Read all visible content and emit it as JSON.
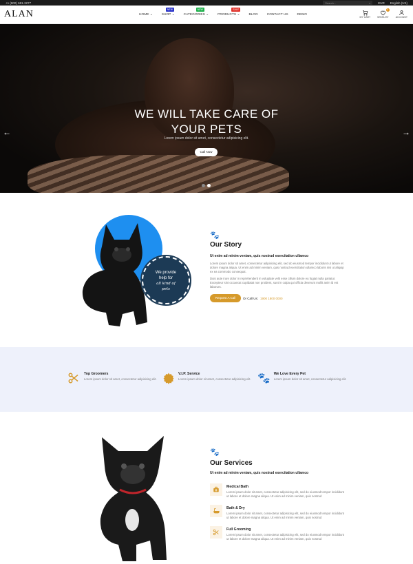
{
  "topbar": {
    "phone": "+1 (800) 681-3277",
    "search_placeholder": "Search...",
    "currency": "EUR",
    "language": "English (US)"
  },
  "header": {
    "logo": "ALAN",
    "nav": [
      {
        "label": "HOME",
        "caret": "⌄"
      },
      {
        "label": "SHOP",
        "caret": "⌄",
        "badge": "NEW",
        "badge_color": "#2b35c9"
      },
      {
        "label": "CATEGORIES",
        "caret": "⌄",
        "badge": "NEW",
        "badge_color": "#1fb14c"
      },
      {
        "label": "PRODUCTS",
        "caret": "⌄",
        "badge": "SALE",
        "badge_color": "#e0322b"
      },
      {
        "label": "BLOG",
        "caret": ""
      },
      {
        "label": "CONTACT US",
        "caret": ""
      },
      {
        "label": "DEMO",
        "caret": ""
      }
    ],
    "icons": {
      "cart": "MY CART",
      "wishlist": "WISHLIST",
      "account": "ACCOUNT",
      "wishlist_count": "0"
    }
  },
  "hero": {
    "title_line1": "WE WILL TAKE CARE OF",
    "title_line2": "YOUR PETS",
    "subtitle": "Lorem ipsum dolor sit amet, consectetur adipisicing elit.",
    "cta": "Call Now",
    "prev_icon": "arrow-left-icon",
    "next_icon": "arrow-right-icon"
  },
  "story": {
    "title": "Our Story",
    "bold": "Ut enim ad minim veniam, quis nostrud exercitation ullamco",
    "para1": "Lorem ipsum dolor sit amet, consectetur adipisicing elit, sed do eiusmod tempor incididunt ut labore et dolore magna aliqua. Ut enim ad minim veniam, quis nostrud exercitation ullamco laboris nisi ut aliquip ex ea commodo consequat.",
    "para2": "Duis aute irure dolor in reprehenderit in voluptate velit esse cillum dolore eu fugiat nulla pariatur. Excepteur sint occaecat cupidatat non proident, sunt in culpa qui officia deserunt mollit anim id est laborum.",
    "button": "Request A Call",
    "or_call": "Or Call Us:",
    "phone": "1900 1800 0000",
    "bubble_line1": "We provide",
    "bubble_line2": "help for",
    "bubble_line3": "all kind of",
    "bubble_line4": "pets"
  },
  "features": [
    {
      "title": "Top Groomers",
      "desc": "Lorem ipsum dolor sit amet, consectetur adipisicing elit.",
      "icon": "scissors-icon"
    },
    {
      "title": "V.I.P. Service",
      "desc": "Lorem ipsum dolor sit amet, consectetur adipisicing elit.",
      "icon": "badge-icon"
    },
    {
      "title": "We Love Every Pet",
      "desc": "Lorem ipsum dolor sit amet, consectetur adipisicing elit.",
      "icon": "paw-icon"
    }
  ],
  "services": {
    "title": "Our Services",
    "bold": "Ut enim ad minim veniam, quis nostrud exercitation ullamco",
    "items": [
      {
        "title": "Medical Bath",
        "desc": "Lorem ipsum dolor sit amet, consectetur adipisicing elit, sed do eiusmod tempor incididunt ut labore et dolore magna aliqua. Ut enim ad minim veniam, quis nostrud",
        "icon": "medical-kit-icon"
      },
      {
        "title": "Bath & Dry",
        "desc": "Lorem ipsum dolor sit amet, consectetur adipisicing elit, sed do eiusmod tempor incididunt ut labore et dolore magna aliqua. Ut enim ad minim veniam, quis nostrud",
        "icon": "bathtub-icon"
      },
      {
        "title": "Full Grooming",
        "desc": "Lorem ipsum dolor sit amet, consectetur adipisicing elit, sed do eiusmod tempor incididunt ut labore et dolore magna aliqua. Ut enim ad minim veniam, quis nostrud",
        "icon": "scissors-icon"
      }
    ]
  }
}
